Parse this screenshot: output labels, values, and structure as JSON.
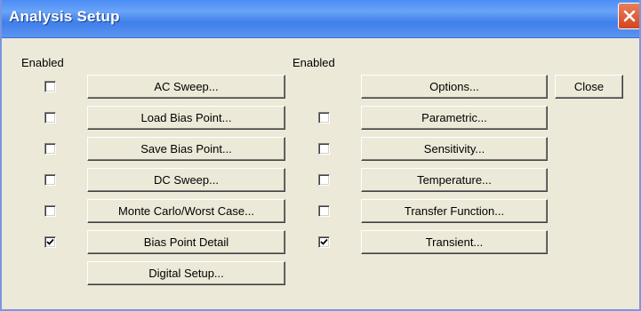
{
  "window": {
    "title": "Analysis Setup"
  },
  "left_column": {
    "enabled_label": "Enabled",
    "items": [
      {
        "label": "AC Sweep...",
        "enabled": false,
        "has_checkbox": true
      },
      {
        "label": "Load Bias Point...",
        "enabled": false,
        "has_checkbox": true
      },
      {
        "label": "Save Bias Point...",
        "enabled": false,
        "has_checkbox": true
      },
      {
        "label": "DC Sweep...",
        "enabled": false,
        "has_checkbox": true
      },
      {
        "label": "Monte Carlo/Worst Case...",
        "enabled": false,
        "has_checkbox": true
      },
      {
        "label": "Bias Point Detail",
        "enabled": true,
        "has_checkbox": true
      },
      {
        "label": "Digital Setup...",
        "enabled": false,
        "has_checkbox": false
      }
    ]
  },
  "right_column": {
    "enabled_label": "Enabled",
    "items": [
      {
        "label": "Options...",
        "enabled": false,
        "has_checkbox": false
      },
      {
        "label": "Parametric...",
        "enabled": false,
        "has_checkbox": true
      },
      {
        "label": "Sensitivity...",
        "enabled": false,
        "has_checkbox": true
      },
      {
        "label": "Temperature...",
        "enabled": false,
        "has_checkbox": true
      },
      {
        "label": "Transfer Function...",
        "enabled": false,
        "has_checkbox": true
      },
      {
        "label": "Transient...",
        "enabled": true,
        "has_checkbox": true
      }
    ]
  },
  "close_button": {
    "label": "Close"
  },
  "colors": {
    "title_bar": "#4c8cf7",
    "dialog_bg": "#ece9d8",
    "close_x": "#d4441c"
  }
}
